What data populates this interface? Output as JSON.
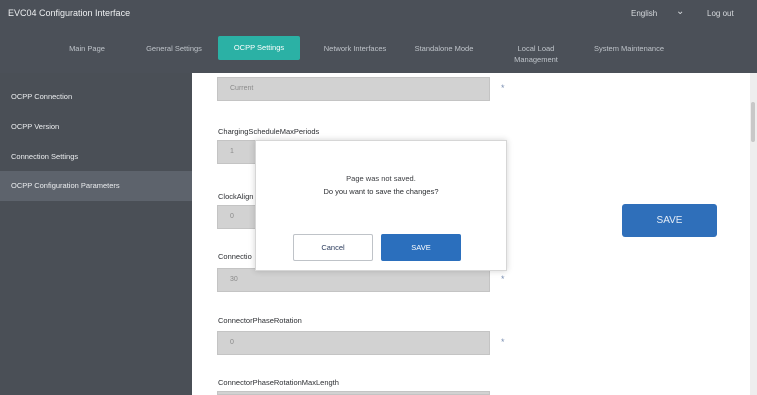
{
  "header": {
    "title": "EVC04 Configuration Interface",
    "language": "English",
    "logout": "Log out",
    "nav": [
      {
        "label": "Main Page"
      },
      {
        "label": "General Settings"
      },
      {
        "label": "OCPP Settings"
      },
      {
        "label": "Network Interfaces"
      },
      {
        "label": "Standalone Mode"
      },
      {
        "label": "Local Load Management"
      },
      {
        "label": "System Maintenance"
      }
    ]
  },
  "sidebar": {
    "items": [
      {
        "label": "OCPP Connection"
      },
      {
        "label": "OCPP Version"
      },
      {
        "label": "Connection Settings"
      },
      {
        "label": "OCPP Configuration Parameters"
      }
    ]
  },
  "form": {
    "fields": [
      {
        "label": "",
        "value": "Current"
      },
      {
        "label": "ChargingScheduleMaxPeriods",
        "value": "1"
      },
      {
        "label": "ClockAlign",
        "value": "0"
      },
      {
        "label": "Connectio",
        "value": "30"
      },
      {
        "label": "ConnectorPhaseRotation",
        "value": "0"
      },
      {
        "label": "ConnectorPhaseRotationMaxLength",
        "value": ""
      }
    ],
    "required_marker": "*",
    "save_label": "SAVE"
  },
  "dialog": {
    "message_line1": "Page was not saved.",
    "message_line2": "Do you want to save the changes?",
    "cancel_label": "Cancel",
    "save_label": "SAVE"
  },
  "colors": {
    "header_bg": "#4b5058",
    "active_tab": "#2bb1a5",
    "sidebar_bg": "#4a4f56",
    "primary_button": "#2b6fbd"
  }
}
